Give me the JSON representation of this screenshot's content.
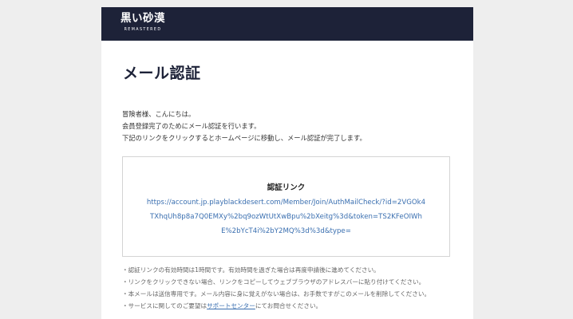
{
  "header": {
    "logo_title": "黒い砂漠",
    "logo_subtitle": "REMASTERED"
  },
  "page_title": "メール認証",
  "intro": {
    "line1": "冒険者様、こんにちは。",
    "line2": "会員登録完了のためにメール認証を行います。",
    "line3": "下記のリンクをクリックするとホームページに移動し、メール認証が完了します。"
  },
  "auth_link": {
    "title": "認証リンク",
    "url_line1": "https://account.jp.playblackdesert.com/Member/Join/AuthMailCheck/?id=2VGOk4",
    "url_line2": "TXhqUh8p8a7Q0EMXy%2bq9ozWtUtXwBpu%2bXeitg%3d&token=TS2KFeOIWh",
    "url_line3": "E%2bYcT4i%2bY2MQ%3d%3d&type="
  },
  "notes": {
    "note1": "・認証リンクの有効時間は1時間です。有効時間を過ぎた場合は再度申請後に進めてください。",
    "note2": "・リンクをクリックできない場合、リンクをコピーしてウェブブラウザのアドレスバーに貼り付けてください。",
    "note3": "・本メールは送信専用です。メール内容に身に覚えがない場合は、お手数ですがこのメールを削除してください。",
    "note4_prefix": "・サービスに関してのご要望は",
    "note4_link": "サポートセンター",
    "note4_suffix": "にてお問合せください。"
  }
}
